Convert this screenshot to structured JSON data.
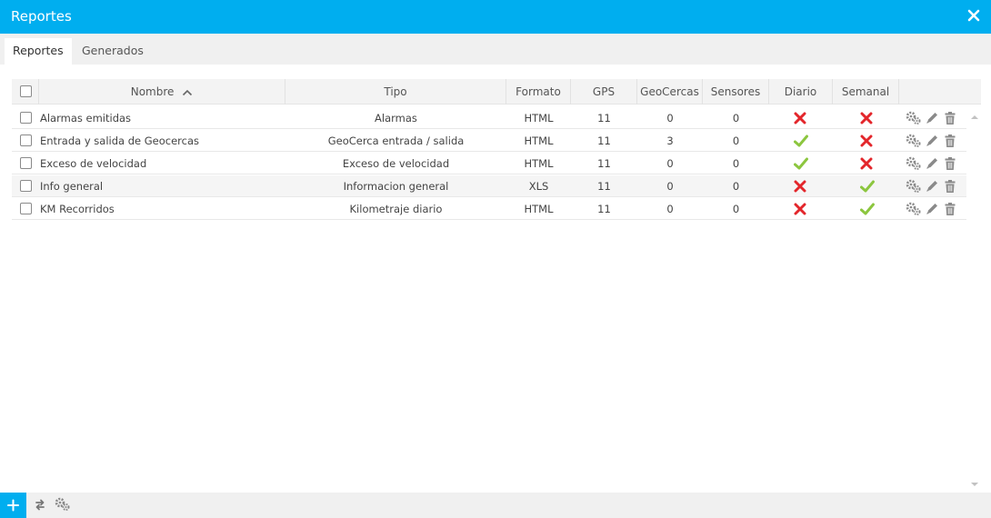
{
  "window": {
    "title": "Reportes",
    "close_icon": "close-icon"
  },
  "tabs": [
    {
      "label": "Reportes",
      "active": true
    },
    {
      "label": "Generados",
      "active": false
    }
  ],
  "table": {
    "columns": {
      "nombre": "Nombre",
      "tipo": "Tipo",
      "formato": "Formato",
      "gps": "GPS",
      "geocercas": "GeoCercas",
      "sensores": "Sensores",
      "diario": "Diario",
      "semanal": "Semanal"
    },
    "sort": {
      "column": "nombre",
      "direction": "ascending",
      "icon": "chevron-up-icon"
    },
    "rows": [
      {
        "nombre": "Alarmas emitidas",
        "tipo": "Alarmas",
        "formato": "HTML",
        "gps": "11",
        "geocercas": "0",
        "sensores": "0",
        "diario": false,
        "semanal": false
      },
      {
        "nombre": "Entrada y salida de Geocercas",
        "tipo": "GeoCerca entrada / salida",
        "formato": "HTML",
        "gps": "11",
        "geocercas": "3",
        "sensores": "0",
        "diario": true,
        "semanal": false
      },
      {
        "nombre": "Exceso de velocidad",
        "tipo": "Exceso de velocidad",
        "formato": "HTML",
        "gps": "11",
        "geocercas": "0",
        "sensores": "0",
        "diario": true,
        "semanal": false
      },
      {
        "nombre": "Info general",
        "tipo": "Informacion general",
        "formato": "XLS",
        "gps": "11",
        "geocercas": "0",
        "sensores": "0",
        "diario": false,
        "semanal": true
      },
      {
        "nombre": "KM Recorridos",
        "tipo": "Kilometraje diario",
        "formato": "HTML",
        "gps": "11",
        "geocercas": "0",
        "sensores": "0",
        "diario": false,
        "semanal": true
      }
    ],
    "row_actions": [
      "gears-icon",
      "pencil-icon",
      "trash-icon"
    ]
  },
  "footer": {
    "icons": [
      "plus-icon",
      "refresh-icon",
      "gears-icon"
    ]
  },
  "colors": {
    "accent": "#00aeef",
    "yes": "#8cc63f",
    "no": "#e3262b",
    "icon_gray": "#8a8a8a"
  }
}
